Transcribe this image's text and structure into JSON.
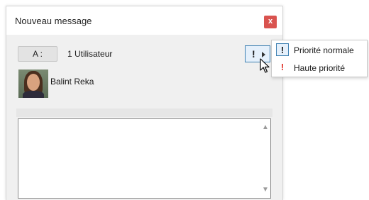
{
  "window": {
    "title": "Nouveau message",
    "close_label": "x"
  },
  "recipients": {
    "to_label": "A :",
    "count_text": "1 Utilisateur",
    "name": "Balint Reka"
  },
  "priority_button": {
    "icon": "!"
  },
  "priority_menu": [
    {
      "icon": "!",
      "label": "Priorité normale",
      "icon_color": "#1a1a1a"
    },
    {
      "icon": "!",
      "label": "Haute priorité",
      "icon_color": "#e0352b"
    }
  ],
  "scrollbar": {
    "up": "▲",
    "down": "▼"
  },
  "colors": {
    "close": "#d9534f",
    "accent": "#3c7fb1",
    "high_priority": "#e0352b"
  }
}
